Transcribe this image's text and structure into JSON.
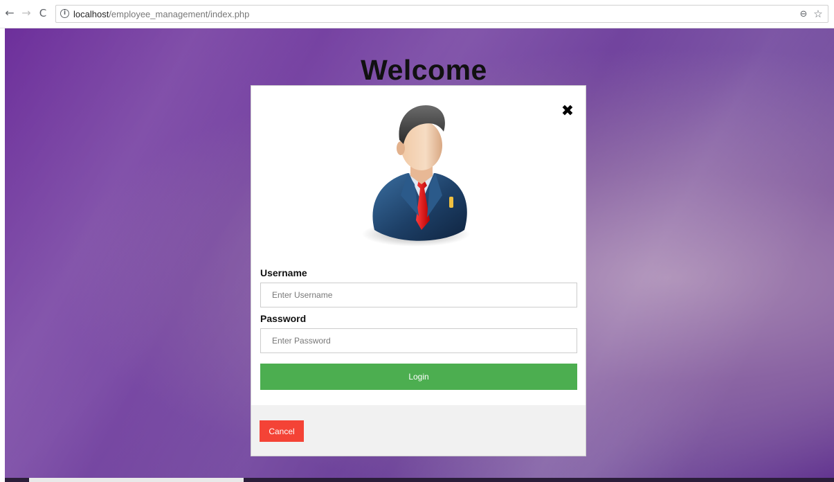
{
  "browser": {
    "url_host": "localhost",
    "url_path": "/employee_management/index.php",
    "back_glyph": "←",
    "forward_glyph": "→",
    "reload_glyph": "C",
    "info_glyph": "i",
    "zoom_glyph": "⊖",
    "star_glyph": "☆"
  },
  "page": {
    "heading": "Welcome"
  },
  "modal": {
    "close_glyph": "✖",
    "avatar_icon": "businessman-avatar-icon",
    "username_label": "Username",
    "username_placeholder": "Enter Username",
    "username_value": "",
    "password_label": "Password",
    "password_placeholder": "Enter Password",
    "password_value": "",
    "login_label": "Login",
    "cancel_label": "Cancel"
  },
  "colors": {
    "login_button": "#4cae50",
    "cancel_button": "#f44336",
    "footer_background": "#f1f1f1",
    "background_accent": "#6d2f9b"
  }
}
